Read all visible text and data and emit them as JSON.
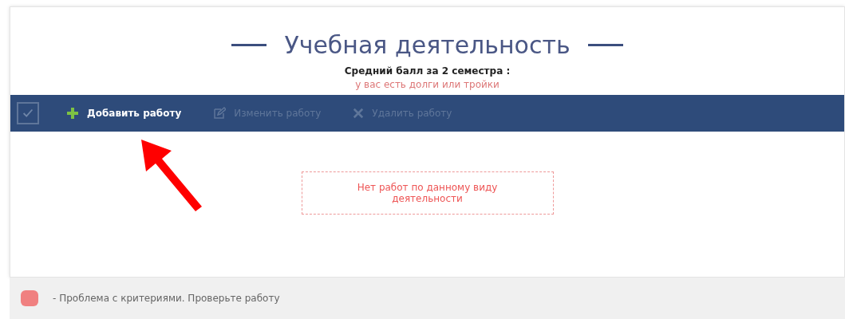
{
  "title": "Учебная деятельность",
  "average": {
    "label": "Средний балл за 2 семестра :",
    "warning": "у вас есть долги или тройки"
  },
  "toolbar": {
    "buttons": [
      {
        "kind": "add",
        "label": "Добавить работу",
        "disabled": false
      },
      {
        "kind": "edit",
        "label": "Изменить работу",
        "disabled": true
      },
      {
        "kind": "delete",
        "label": "Удалить работу",
        "disabled": true
      }
    ]
  },
  "empty_message": "Нет работ по данному виду деятельности",
  "legend": [
    {
      "color": "#f08080",
      "text": "- Проблема с критериями. Проверьте работу"
    }
  ]
}
